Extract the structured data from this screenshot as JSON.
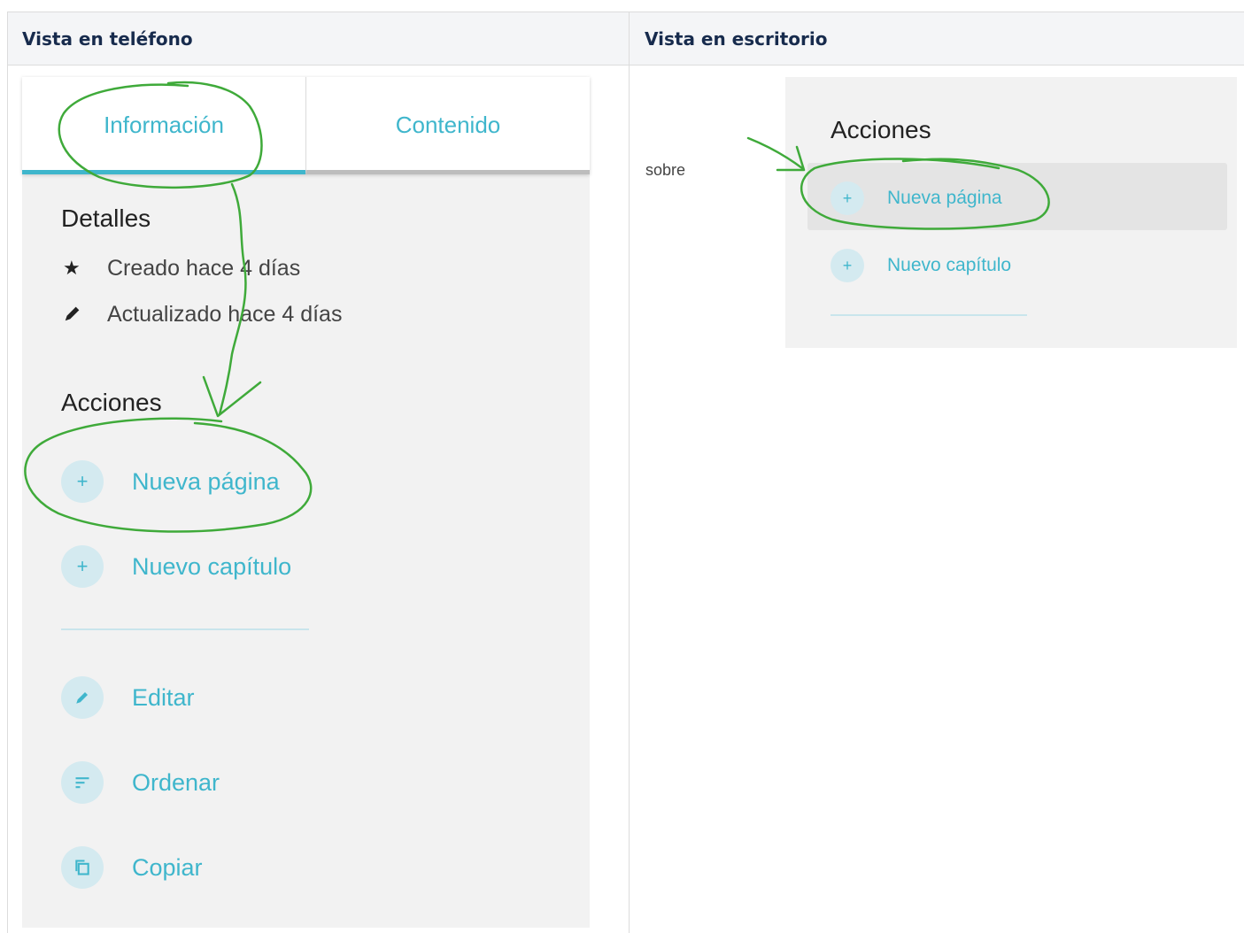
{
  "table": {
    "headers": [
      "Vista en teléfono",
      "Vista en escritorio"
    ]
  },
  "phone": {
    "tabs": [
      "Información",
      "Contenido"
    ],
    "details_title": "Detalles",
    "meta": [
      {
        "icon": "star-icon",
        "text": "Creado hace 4 días"
      },
      {
        "icon": "pencil-icon",
        "text": "Actualizado hace 4 días"
      }
    ],
    "actions_title": "Acciones",
    "actions": [
      {
        "icon": "plus-icon",
        "label": "Nueva página"
      },
      {
        "icon": "plus-icon",
        "label": "Nuevo capítulo"
      },
      {
        "icon": "pencil-icon",
        "label": "Editar"
      },
      {
        "icon": "sort-icon",
        "label": "Ordenar"
      },
      {
        "icon": "copy-icon",
        "label": "Copiar"
      }
    ]
  },
  "desktop": {
    "side_text": "sobre",
    "actions_title": "Acciones",
    "actions": [
      {
        "icon": "plus-icon",
        "label": "Nueva página"
      },
      {
        "icon": "plus-icon",
        "label": "Nuevo capítulo"
      }
    ]
  },
  "colors": {
    "accent": "#3fb6cc",
    "annotation": "#3faa3a",
    "panel": "#f2f2f2"
  }
}
